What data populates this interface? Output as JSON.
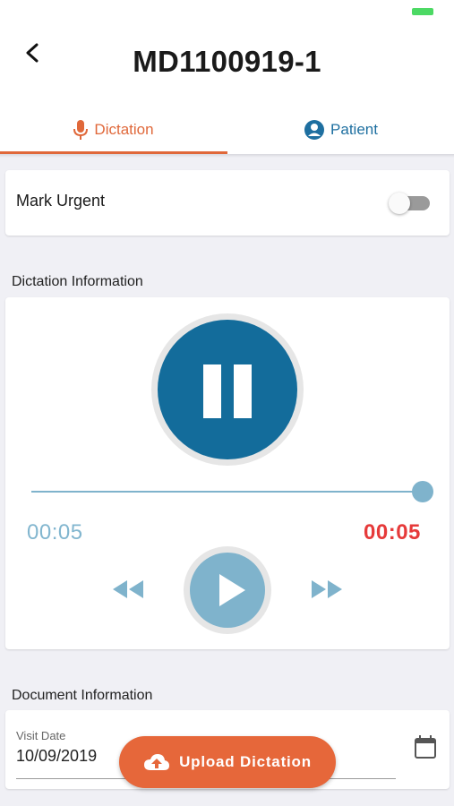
{
  "header": {
    "title": "MD1100919-1"
  },
  "tabs": [
    {
      "label": "Dictation",
      "icon": "microphone-icon",
      "active": true
    },
    {
      "label": "Patient",
      "icon": "account-circle-icon",
      "active": false
    }
  ],
  "urgent": {
    "label": "Mark Urgent",
    "toggle_on": false
  },
  "dictation_section": {
    "label": "Dictation Information"
  },
  "player": {
    "elapsed": "00:05",
    "total": "00:05",
    "progress": 1.0,
    "state": "recording-paused"
  },
  "document_section": {
    "label": "Document Information",
    "visit_date_label": "Visit Date",
    "visit_date_value": "10/09/2019"
  },
  "upload_button": {
    "label": "Upload Dictation"
  },
  "colors": {
    "accent": "#e0683a",
    "primary": "#136c9b",
    "light_blue": "#7fb3cc",
    "alert_red": "#e63a3a",
    "battery": "#4cd964"
  }
}
